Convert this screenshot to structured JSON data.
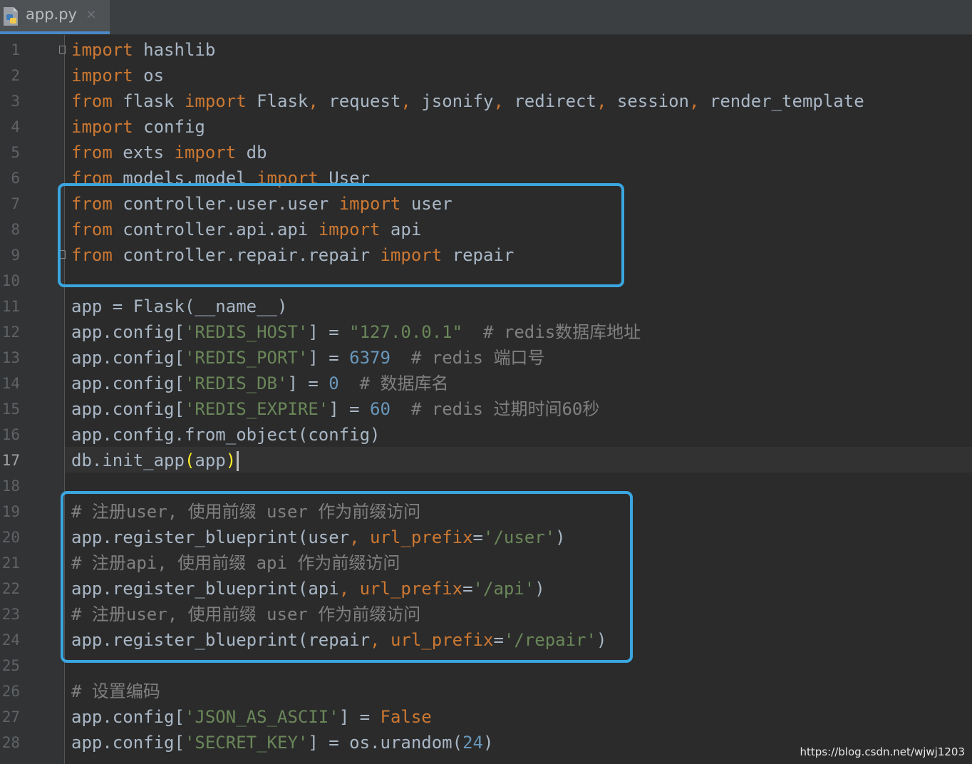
{
  "tab": {
    "filename": "app.py",
    "close_glyph": "×"
  },
  "editor": {
    "line_numbers": [
      "1",
      "2",
      "3",
      "4",
      "5",
      "6",
      "7",
      "8",
      "9",
      "10",
      "11",
      "12",
      "13",
      "14",
      "15",
      "16",
      "17",
      "18",
      "19",
      "20",
      "21",
      "22",
      "23",
      "24",
      "25",
      "26",
      "27",
      "28"
    ],
    "active_line": 17,
    "lines": [
      [
        [
          "kw",
          "import"
        ],
        [
          "t",
          " hashlib"
        ]
      ],
      [
        [
          "kw",
          "import"
        ],
        [
          "t",
          " os"
        ]
      ],
      [
        [
          "kw",
          "from"
        ],
        [
          "t",
          " flask "
        ],
        [
          "kw",
          "import"
        ],
        [
          "t",
          " Flask"
        ],
        [
          "kw",
          ","
        ],
        [
          "t",
          " request"
        ],
        [
          "kw",
          ","
        ],
        [
          "t",
          " jsonify"
        ],
        [
          "kw",
          ","
        ],
        [
          "t",
          " redirect"
        ],
        [
          "kw",
          ","
        ],
        [
          "t",
          " session"
        ],
        [
          "kw",
          ","
        ],
        [
          "t",
          " render_template"
        ]
      ],
      [
        [
          "kw",
          "import"
        ],
        [
          "t",
          " config"
        ]
      ],
      [
        [
          "kw",
          "from"
        ],
        [
          "t",
          " exts "
        ],
        [
          "kw",
          "import"
        ],
        [
          "t",
          " db"
        ]
      ],
      [
        [
          "kw",
          "from"
        ],
        [
          "t",
          " models.model "
        ],
        [
          "kw",
          "import"
        ],
        [
          "t",
          " User"
        ]
      ],
      [
        [
          "kw",
          "from"
        ],
        [
          "t",
          " controller.user.user "
        ],
        [
          "kw",
          "import"
        ],
        [
          "t",
          " user"
        ]
      ],
      [
        [
          "kw",
          "from"
        ],
        [
          "t",
          " controller.api.api "
        ],
        [
          "kw",
          "import"
        ],
        [
          "t",
          " api"
        ]
      ],
      [
        [
          "kw",
          "from"
        ],
        [
          "t",
          " controller.repair.repair "
        ],
        [
          "kw",
          "import"
        ],
        [
          "t",
          " repair"
        ]
      ],
      [],
      [
        [
          "t",
          "app = Flask(__name__)"
        ]
      ],
      [
        [
          "t",
          "app.config["
        ],
        [
          "str",
          "'REDIS_HOST'"
        ],
        [
          "t",
          "] = "
        ],
        [
          "str",
          "\"127.0.0.1\""
        ],
        [
          "t",
          "  "
        ],
        [
          "cmt",
          "# redis数据库地址"
        ]
      ],
      [
        [
          "t",
          "app.config["
        ],
        [
          "str",
          "'REDIS_PORT'"
        ],
        [
          "t",
          "] = "
        ],
        [
          "num",
          "6379"
        ],
        [
          "t",
          "  "
        ],
        [
          "cmt",
          "# redis 端口号"
        ]
      ],
      [
        [
          "t",
          "app.config["
        ],
        [
          "str",
          "'REDIS_DB'"
        ],
        [
          "t",
          "] = "
        ],
        [
          "num",
          "0"
        ],
        [
          "t",
          "  "
        ],
        [
          "cmt",
          "# 数据库名"
        ]
      ],
      [
        [
          "t",
          "app.config["
        ],
        [
          "str",
          "'REDIS_EXPIRE'"
        ],
        [
          "t",
          "] = "
        ],
        [
          "num",
          "60"
        ],
        [
          "t",
          "  "
        ],
        [
          "cmt",
          "# redis 过期时间60秒"
        ]
      ],
      [
        [
          "t",
          "app.config.from_object(config)"
        ]
      ],
      [
        [
          "t",
          "db.init_app"
        ],
        [
          "bracket",
          "("
        ],
        [
          "t",
          "app"
        ],
        [
          "bracket",
          ")"
        ],
        [
          "caret",
          ""
        ]
      ],
      [],
      [
        [
          "cmt",
          "# 注册user, 使用前缀 user 作为前缀访问"
        ]
      ],
      [
        [
          "t",
          "app.register_blueprint(user"
        ],
        [
          "kw",
          ","
        ],
        [
          "t",
          " "
        ],
        [
          "kw",
          "url_prefix"
        ],
        [
          "t",
          "="
        ],
        [
          "str",
          "'/user'"
        ],
        [
          "t",
          ")"
        ]
      ],
      [
        [
          "cmt",
          "# 注册api, 使用前缀 api 作为前缀访问"
        ]
      ],
      [
        [
          "t",
          "app.register_blueprint(api"
        ],
        [
          "kw",
          ","
        ],
        [
          "t",
          " "
        ],
        [
          "kw",
          "url_prefix"
        ],
        [
          "t",
          "="
        ],
        [
          "str",
          "'/api'"
        ],
        [
          "t",
          ")"
        ]
      ],
      [
        [
          "cmt",
          "# 注册user, 使用前缀 user 作为前缀访问"
        ]
      ],
      [
        [
          "t",
          "app.register_blueprint(repair"
        ],
        [
          "kw",
          ","
        ],
        [
          "t",
          " "
        ],
        [
          "kw",
          "url_prefix"
        ],
        [
          "t",
          "="
        ],
        [
          "str",
          "'/repair'"
        ],
        [
          "t",
          ")"
        ]
      ],
      [],
      [
        [
          "cmt",
          "# 设置编码"
        ]
      ],
      [
        [
          "t",
          "app.config["
        ],
        [
          "str",
          "'JSON_AS_ASCII'"
        ],
        [
          "t",
          "] = "
        ],
        [
          "kw",
          "False"
        ]
      ],
      [
        [
          "t",
          "app.config["
        ],
        [
          "str",
          "'SECRET_KEY'"
        ],
        [
          "t",
          "] = os.urandom("
        ],
        [
          "num",
          "24"
        ],
        [
          "t",
          ")"
        ]
      ]
    ]
  },
  "watermark": "https://blog.csdn.net/wjwj1203",
  "colors": {
    "background": "#2b2b2b",
    "keyword": "#cc7832",
    "string": "#6a8759",
    "number": "#6897bb",
    "comment": "#808080",
    "text": "#a9b7c6",
    "highlight_box": "#3aa6e0"
  }
}
